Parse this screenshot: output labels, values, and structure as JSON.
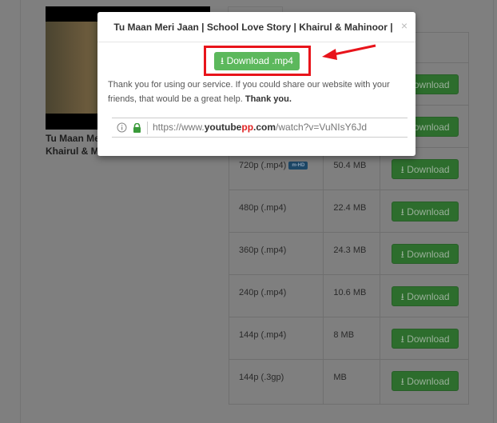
{
  "video": {
    "title_line1": "Tu Maan Meri",
    "title_line2": "Khairul & Mah"
  },
  "table": {
    "rows": [
      {
        "quality": "",
        "badge": "",
        "size": "",
        "button": "Download"
      },
      {
        "quality": "",
        "badge": "",
        "size": "",
        "button": "Download"
      },
      {
        "quality": "720p (.mp4)",
        "badge": "m-HD",
        "size": "50.4 MB",
        "button": "Download"
      },
      {
        "quality": "480p (.mp4)",
        "badge": "",
        "size": "22.4 MB",
        "button": "Download"
      },
      {
        "quality": "360p (.mp4)",
        "badge": "",
        "size": "24.3 MB",
        "button": "Download"
      },
      {
        "quality": "240p (.mp4)",
        "badge": "",
        "size": "10.6 MB",
        "button": "Download"
      },
      {
        "quality": "144p (.mp4)",
        "badge": "",
        "size": "8 MB",
        "button": "Download"
      },
      {
        "quality": "144p (.3gp)",
        "badge": "",
        "size": "MB",
        "button": "Download"
      }
    ]
  },
  "modal": {
    "title": "Tu Maan Meri Jaan | School Love Story | Khairul & Mahinoor | UNIQUE YT",
    "close": "×",
    "download_button": "Download .mp4",
    "message": "Thank you for using our service. If you could share our website with your friends, that would be a great help.",
    "message_bold": "Thank you.",
    "url": {
      "prefix": "https://www.",
      "domain_a": "youtube",
      "domain_b": "pp",
      "domain_c": ".com",
      "path": "/watch?v=VuNIsY6Jd"
    }
  },
  "colors": {
    "overlay_bg": "#7f7f7f",
    "download_green": "#5cb85c",
    "highlight_red": "#e8141b",
    "badge_blue": "#1d4766"
  }
}
